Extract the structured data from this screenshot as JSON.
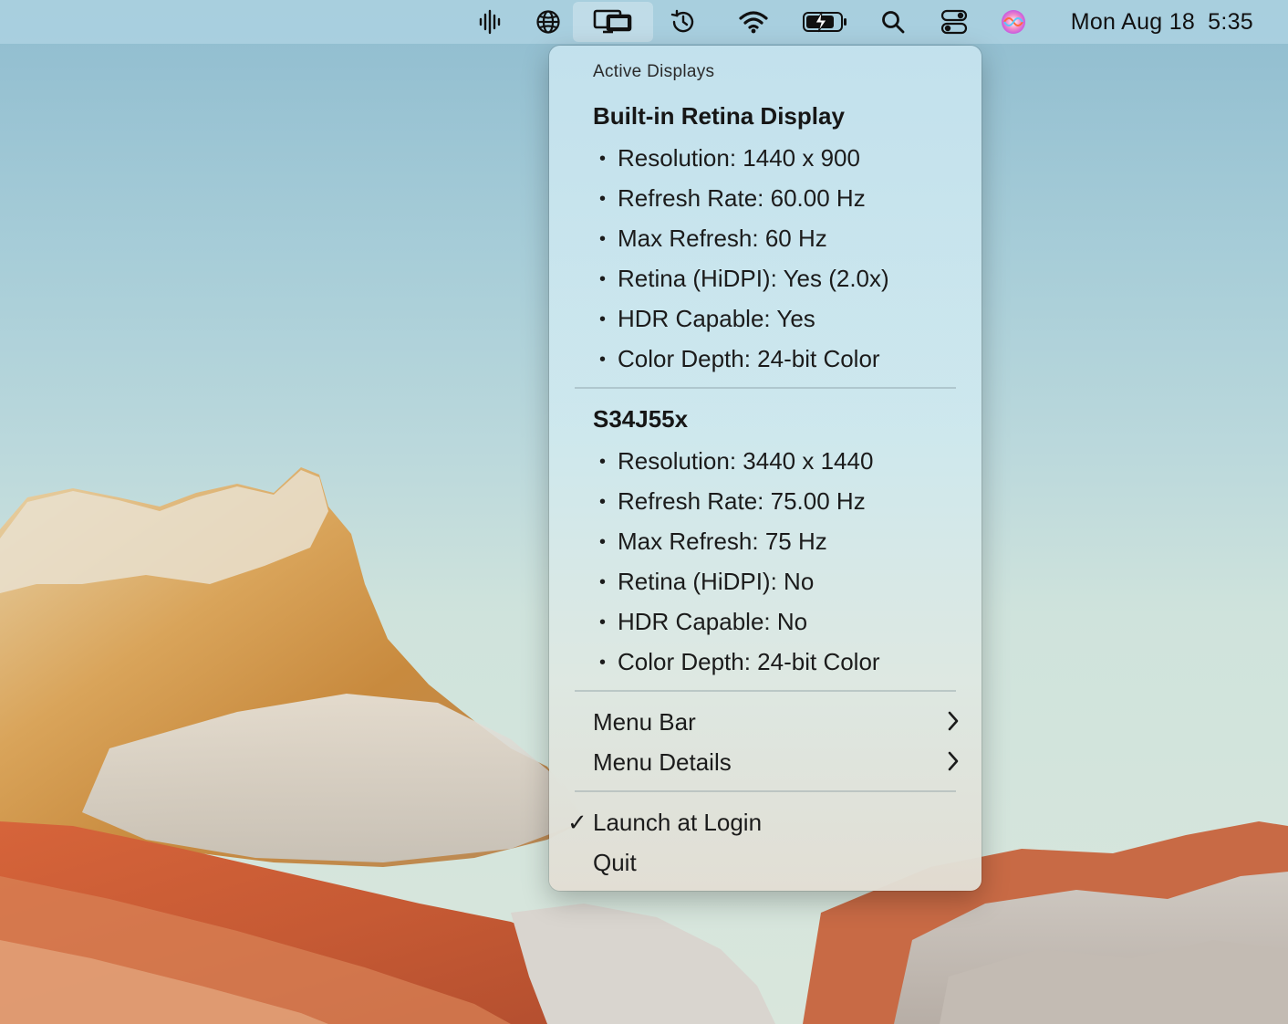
{
  "menubar": {
    "icons": [
      {
        "name": "audio-waveform-icon"
      },
      {
        "name": "globe-icon"
      },
      {
        "name": "displays-icon"
      },
      {
        "name": "time-machine-icon"
      },
      {
        "name": "wifi-icon"
      },
      {
        "name": "battery-charging-icon"
      },
      {
        "name": "spotlight-search-icon"
      },
      {
        "name": "control-center-icon"
      },
      {
        "name": "siri-icon"
      }
    ],
    "date": "Mon Aug 18",
    "time": "5:35"
  },
  "menu": {
    "header": "Active Displays",
    "displays": [
      {
        "name": "Built-in Retina Display",
        "details": [
          "Resolution: 1440 x 900",
          "Refresh Rate: 60.00 Hz",
          "Max Refresh: 60 Hz",
          "Retina (HiDPI): Yes (2.0x)",
          "HDR Capable: Yes",
          "Color Depth: 24-bit Color"
        ]
      },
      {
        "name": "S34J55x",
        "details": [
          "Resolution: 3440 x 1440",
          "Refresh Rate: 75.00 Hz",
          "Max Refresh: 75 Hz",
          "Retina (HiDPI): No",
          "HDR Capable: No",
          "Color Depth: 24-bit Color"
        ]
      }
    ],
    "submenus": [
      "Menu Bar",
      "Menu Details"
    ],
    "launch_at_login": {
      "label": "Launch at Login",
      "checked": true,
      "check_glyph": "✓"
    },
    "quit": "Quit",
    "bullet": "•"
  }
}
